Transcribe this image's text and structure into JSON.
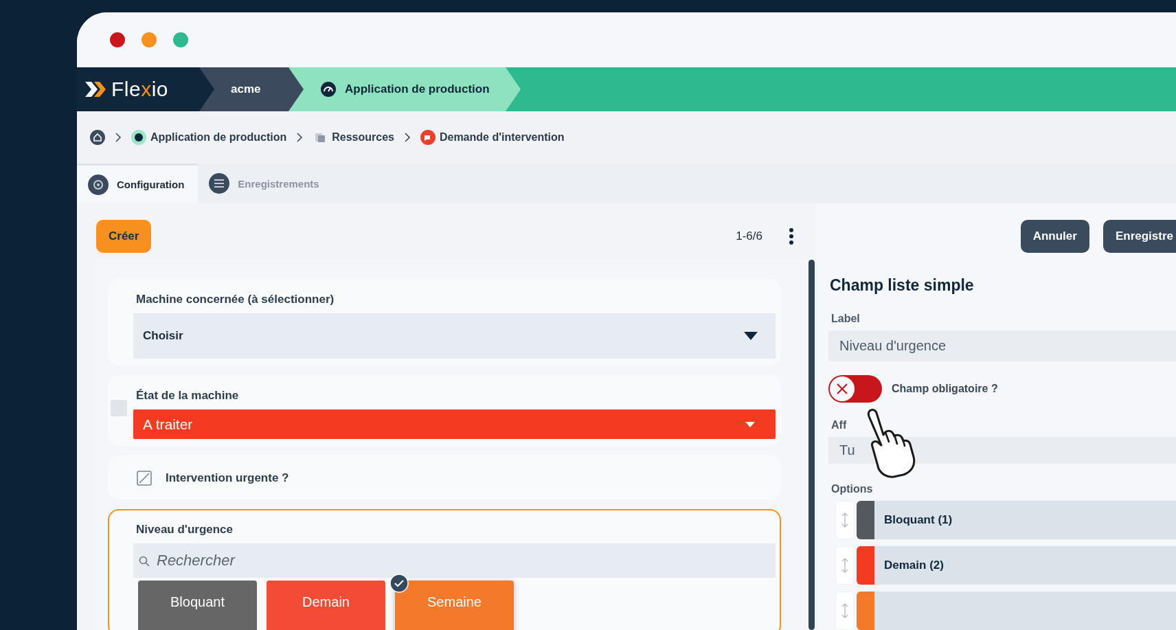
{
  "window": {
    "controls": [
      {
        "color": "#c8161d"
      },
      {
        "color": "#f7901e"
      },
      {
        "color": "#2fb98f"
      }
    ]
  },
  "header": {
    "logo": [
      "Fle",
      "x",
      "io"
    ],
    "segments": [
      {
        "label": "acme",
        "kind": "workspace"
      },
      {
        "label": "Application de production",
        "kind": "app"
      }
    ]
  },
  "breadcrumb": [
    {
      "label": "Application de production",
      "kind": "app"
    },
    {
      "label": "Ressources",
      "kind": "resources"
    },
    {
      "label": "Demande d'intervention",
      "kind": "form"
    }
  ],
  "tabs": [
    {
      "label": "Configuration",
      "selected": true
    },
    {
      "label": "Enregistrements",
      "selected": false
    }
  ],
  "list": {
    "create_button": "Créer",
    "pagination": "1-6/6",
    "fields": [
      {
        "kind": "select",
        "label": "Machine concernée (à sélectionner)",
        "value": "Choisir",
        "focused": false
      },
      {
        "kind": "status",
        "label": "État de la machine",
        "value": "A traiter",
        "color": "#f33b22",
        "focused": false
      },
      {
        "kind": "checkbox",
        "label": "Intervention urgente ?",
        "checked": false,
        "focused": false
      },
      {
        "kind": "chips",
        "label": "Niveau d'urgence",
        "placeholder": "Rechercher",
        "focused": true,
        "options": [
          {
            "label": "Bloquant",
            "color": "#666666",
            "selected": false
          },
          {
            "label": "Demain",
            "color": "#f24b36",
            "selected": false
          },
          {
            "label": "Semaine",
            "color": "#f5792a",
            "selected": true
          }
        ]
      }
    ]
  },
  "editor": {
    "buttons": [
      "Annuler",
      "Enregistre"
    ],
    "title": "Champ liste simple",
    "label_caption": "Label",
    "label_value": "Niveau d'urgence",
    "required": {
      "label": "Champ obligatoire ?",
      "on": false
    },
    "display_caption": "Aff",
    "display_value": "Tu",
    "options_caption": "Options",
    "options": [
      {
        "label": "Bloquant (1)",
        "color": "#55595e"
      },
      {
        "label": "Demain (2)",
        "color": "#f33b22"
      },
      {
        "color": "#f5792a"
      }
    ]
  }
}
